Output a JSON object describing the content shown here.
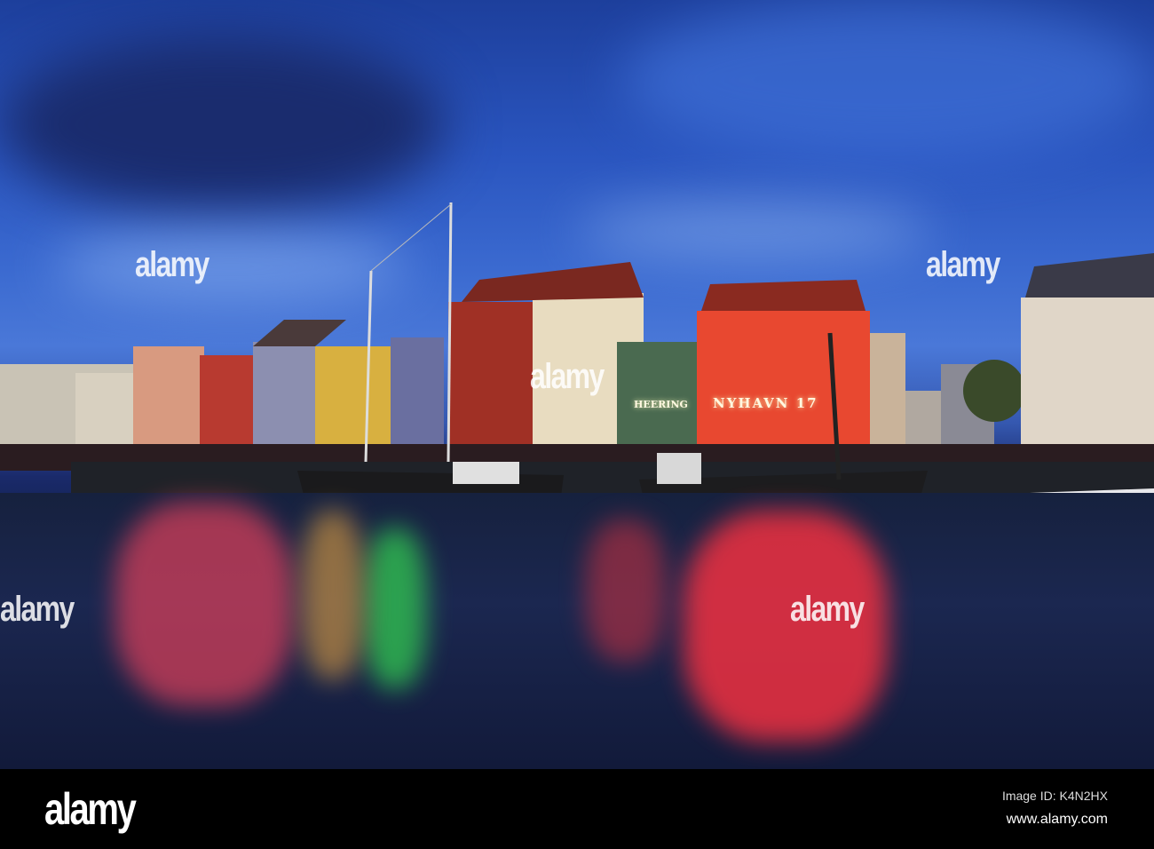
{
  "photo": {
    "subject": "",
    "signs": {
      "heering": "HEERING",
      "nyhavn": "NYHAVN 17"
    },
    "watermark": "alamy"
  },
  "footer": {
    "logo": "alamy",
    "image_id": "Image ID: K4N2HX",
    "website": "www.alamy.com"
  }
}
